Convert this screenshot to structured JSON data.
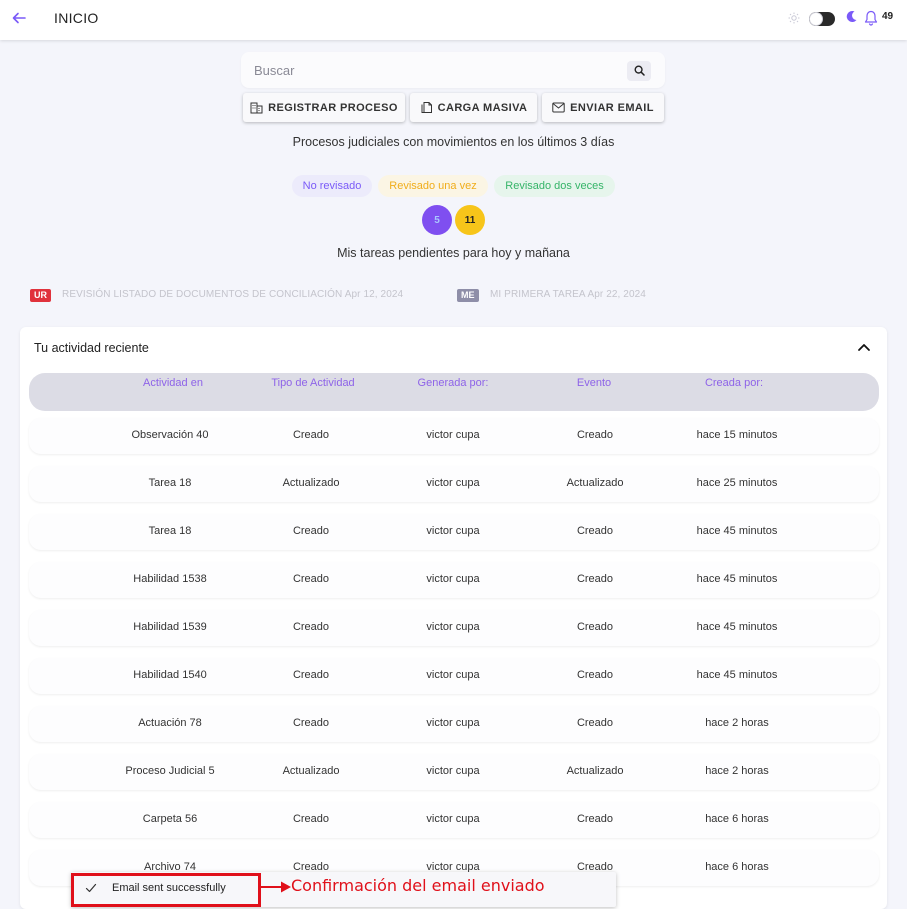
{
  "header": {
    "title": "INICIO",
    "notification_count": "49",
    "icons": [
      "arrow-left-icon",
      "sun-icon",
      "moon-icon",
      "bell-icon"
    ]
  },
  "search": {
    "placeholder": "Buscar"
  },
  "actions": {
    "register": "REGISTRAR PROCESO",
    "bulk": "CARGA MASIVA",
    "email": "ENVIAR EMAIL"
  },
  "processes": {
    "subtitle": "Procesos judiciales con movimientos en los últimos 3 días",
    "badges": [
      "No revisado",
      "Revisado una vez",
      "Revisado dos veces"
    ],
    "counts": [
      "5",
      "11"
    ]
  },
  "tasks": {
    "subtitle": "Mis tareas pendientes para hoy y mañana",
    "items": [
      {
        "tag": "UR",
        "text": "REVISIÓN LISTADO DE DOCUMENTOS DE CONCILIACIÓN Apr 12, 2024"
      },
      {
        "tag": "ME",
        "text": "MI PRIMERA TAREA Apr 22, 2024"
      }
    ]
  },
  "activity": {
    "title": "Tu actividad reciente",
    "columns": [
      "Actividad en",
      "Tipo de Actividad",
      "Generada por:",
      "Evento",
      "Creada por:"
    ],
    "rows": [
      [
        "Observación 40",
        "Creado",
        "victor cupa",
        "Creado",
        "hace 15 minutos"
      ],
      [
        "Tarea 18",
        "Actualizado",
        "victor cupa",
        "Actualizado",
        "hace 25 minutos"
      ],
      [
        "Tarea 18",
        "Creado",
        "victor cupa",
        "Creado",
        "hace 45 minutos"
      ],
      [
        "Habilidad 1538",
        "Creado",
        "victor cupa",
        "Creado",
        "hace 45 minutos"
      ],
      [
        "Habilidad 1539",
        "Creado",
        "victor cupa",
        "Creado",
        "hace 45 minutos"
      ],
      [
        "Habilidad 1540",
        "Creado",
        "victor cupa",
        "Creado",
        "hace 45 minutos"
      ],
      [
        "Actuación 78",
        "Creado",
        "victor cupa",
        "Creado",
        "hace 2 horas"
      ],
      [
        "Proceso Judicial 5",
        "Actualizado",
        "victor cupa",
        "Actualizado",
        "hace 2 horas"
      ],
      [
        "Carpeta 56",
        "Creado",
        "victor cupa",
        "Creado",
        "hace 6 horas"
      ],
      [
        "Archivo 74",
        "Creado",
        "victor cupa",
        "Creado",
        "hace 6 horas"
      ]
    ]
  },
  "toast": {
    "message": "Email sent successfully"
  },
  "annotation": {
    "text": "Confirmación del email enviado"
  },
  "colors": {
    "accent": "#7a5af8",
    "badge_no_revisado_bg": "#ecebfb",
    "badge_no_revisado_fg": "#7a5af8",
    "badge_una_vez_bg": "#fbf5e4",
    "badge_una_vez_fg": "#f0ad1b",
    "badge_dos_veces_bg": "#e6f5ec",
    "badge_dos_veces_fg": "#35b468",
    "counter_purple": "#7f4ff0",
    "counter_yellow": "#f7c51a",
    "tag_ur": "#e0323c",
    "tag_me": "#8e8ea8",
    "annotation_red": "#e0101a"
  }
}
